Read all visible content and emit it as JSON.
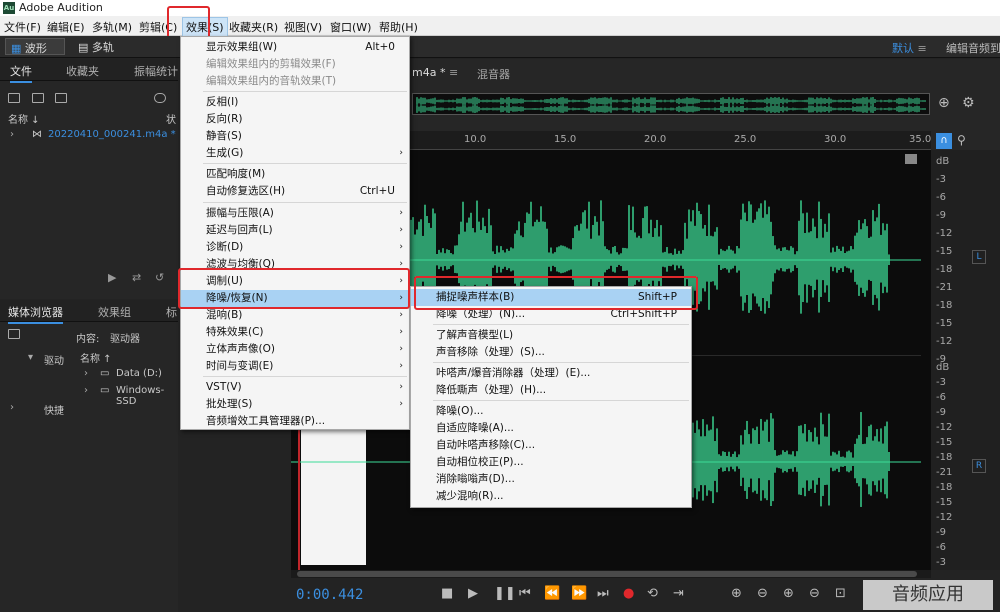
{
  "window": {
    "title": "Adobe Audition",
    "logo_text": "Au"
  },
  "menubar": {
    "items": [
      "文件(F)",
      "编辑(E)",
      "多轨(M)",
      "剪辑(C)",
      "效果(S)",
      "收藏夹(R)",
      "视图(V)",
      "窗口(W)",
      "帮助(H)"
    ]
  },
  "toolbar": {
    "wave_label": "波形",
    "multi_label": "多轨",
    "default_label": "默认",
    "edit_label": "编辑音频到"
  },
  "files_panel": {
    "tabs": [
      "文件",
      "收藏夹",
      "振幅统计"
    ],
    "col_name": "名称 ↓",
    "col_status": "状",
    "file": "20220410_000241.m4a *"
  },
  "media_panel": {
    "tabs": [
      "媒体浏览器",
      "效果组",
      "标"
    ],
    "content_label": "内容:",
    "content_value": "驱动器",
    "col_name": "名称 ↑",
    "drive_label": "驱动",
    "drive1": "Data (D:)",
    "drive2": "Windows-SSD",
    "fast_label": "快捷"
  },
  "editor": {
    "tab_file": "m4a *",
    "tab_mixer": "混音器"
  },
  "ruler": {
    "ticks": [
      "10.0",
      "15.0",
      "20.0",
      "25.0",
      "30.0",
      "35.0"
    ]
  },
  "db_top": [
    "dB",
    "-3",
    "-6",
    "-9",
    "-12",
    "-15",
    "-18",
    "-21",
    "-18",
    "-15",
    "-12",
    "-9"
  ],
  "db_bottom": [
    "dB",
    "-3",
    "-6",
    "-9",
    "-12",
    "-15",
    "-18",
    "-21",
    "-18",
    "-15",
    "-12",
    "-9",
    "-6",
    "-3"
  ],
  "channels": {
    "left": "L",
    "right": "R"
  },
  "effects_menu": [
    {
      "label": "显示效果组(W)",
      "shortcut": "Alt+0"
    },
    {
      "label": "编辑效果组内的剪辑效果(F)",
      "disabled": true
    },
    {
      "label": "编辑效果组内的音轨效果(T)",
      "disabled": true
    },
    {
      "label": "反相(I)"
    },
    {
      "label": "反向(R)"
    },
    {
      "label": "静音(S)"
    },
    {
      "label": "生成(G)",
      "submenu": true
    },
    {
      "label": "匹配响度(M)"
    },
    {
      "label": "自动修复选区(H)",
      "shortcut": "Ctrl+U"
    },
    {
      "label": "振幅与压限(A)",
      "submenu": true
    },
    {
      "label": "延迟与回声(L)",
      "submenu": true
    },
    {
      "label": "诊断(D)",
      "submenu": true
    },
    {
      "label": "滤波与均衡(Q)",
      "submenu": true
    },
    {
      "label": "调制(U)",
      "submenu": true
    },
    {
      "label": "降噪/恢复(N)",
      "submenu": true
    },
    {
      "label": "混响(B)",
      "submenu": true
    },
    {
      "label": "特殊效果(C)",
      "submenu": true
    },
    {
      "label": "立体声声像(O)",
      "submenu": true
    },
    {
      "label": "时间与变调(E)",
      "submenu": true
    },
    {
      "label": "VST(V)",
      "submenu": true
    },
    {
      "label": "批处理(S)",
      "submenu": true
    },
    {
      "label": "音频增效工具管理器(P)..."
    }
  ],
  "noise_menu": [
    {
      "label": "捕捉噪声样本(B)",
      "shortcut": "Shift+P"
    },
    {
      "label": "降噪（处理）(N)...",
      "shortcut": "Ctrl+Shift+P"
    },
    {
      "label": "了解声音模型(L)"
    },
    {
      "label": "声音移除（处理）(S)..."
    },
    {
      "label": "咔嗒声/爆音消除器（处理）(E)..."
    },
    {
      "label": "降低嘶声（处理）(H)..."
    },
    {
      "label": "降噪(O)..."
    },
    {
      "label": "自适应降噪(A)..."
    },
    {
      "label": "自动咔嗒声移除(C)..."
    },
    {
      "label": "自动相位校正(P)..."
    },
    {
      "label": "消除嗡嗡声(D)..."
    },
    {
      "label": "减少混响(R)..."
    }
  ],
  "transport": {
    "time": "0:00.442"
  },
  "watermark": "音频应用",
  "colors": {
    "wave": "#3ddc97",
    "accent": "#3b8fe0",
    "highlight": "#a9d2f3",
    "redbox": "#e0282c"
  }
}
